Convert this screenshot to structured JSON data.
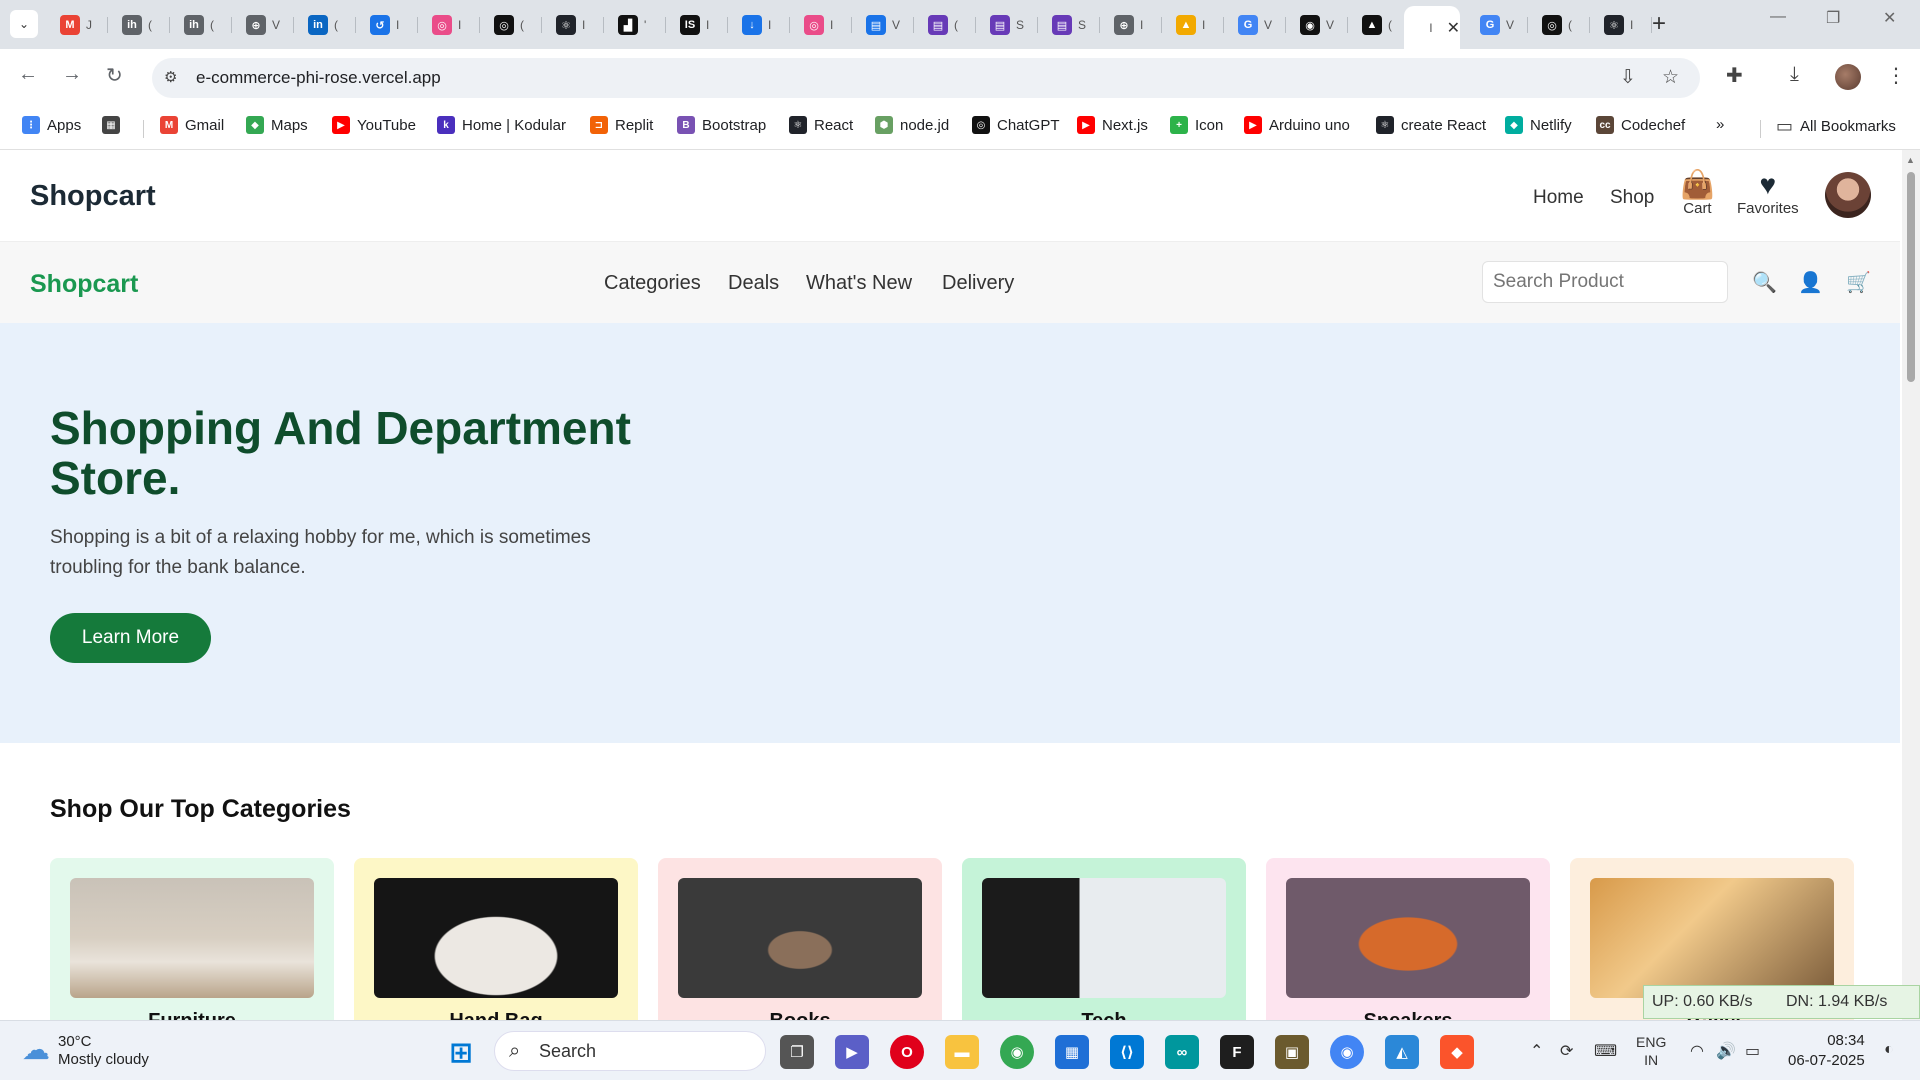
{
  "browser": {
    "tabs": [
      {
        "icon": "gmail-icon",
        "label": "M",
        "color": "#ea4335",
        "text": "J"
      },
      {
        "icon": "ih-icon",
        "label": "ih",
        "color": "#5f6368",
        "text": "("
      },
      {
        "icon": "ih-icon",
        "label": "ih",
        "color": "#5f6368",
        "text": "("
      },
      {
        "icon": "globe-icon",
        "label": "⊕",
        "color": "#5f6368",
        "text": "V"
      },
      {
        "icon": "linkedin-icon",
        "label": "in",
        "color": "#0a66c2",
        "text": "("
      },
      {
        "icon": "history-icon",
        "label": "↺",
        "color": "#1a73e8",
        "text": "I"
      },
      {
        "icon": "dribbble-icon",
        "label": "◎",
        "color": "#ea4c89",
        "text": "I"
      },
      {
        "icon": "chatgpt-icon",
        "label": "◎",
        "color": "#111",
        "text": "("
      },
      {
        "icon": "react-icon",
        "label": "⚛",
        "color": "#20232a",
        "text": "I"
      },
      {
        "icon": "unsplash-icon",
        "label": "▟",
        "color": "#111",
        "text": "'"
      },
      {
        "icon": "is-icon",
        "label": "IS",
        "color": "#111",
        "text": "I"
      },
      {
        "icon": "download-icon",
        "label": "↓",
        "color": "#1a73e8",
        "text": "I"
      },
      {
        "icon": "dribbble-icon",
        "label": "◎",
        "color": "#ea4c89",
        "text": "I"
      },
      {
        "icon": "forms-icon",
        "label": "▤",
        "color": "#1a73e8",
        "text": "V"
      },
      {
        "icon": "forms-icon",
        "label": "▤",
        "color": "#673ab7",
        "text": "("
      },
      {
        "icon": "forms-icon",
        "label": "▤",
        "color": "#673ab7",
        "text": "S"
      },
      {
        "icon": "forms-icon",
        "label": "▤",
        "color": "#673ab7",
        "text": "S"
      },
      {
        "icon": "globe-icon",
        "label": "⊕",
        "color": "#5f6368",
        "text": "I"
      },
      {
        "icon": "academy-icon",
        "label": "▲",
        "color": "#f2a900",
        "text": "I"
      },
      {
        "icon": "google-icon",
        "label": "G",
        "color": "#4285f4",
        "text": "V"
      },
      {
        "icon": "github-icon",
        "label": "◉",
        "color": "#111",
        "text": "V"
      },
      {
        "icon": "vercel-icon",
        "label": "▲",
        "color": "#111",
        "text": "("
      },
      {
        "icon": "page-icon",
        "label": "",
        "color": "#fff",
        "text": "I"
      },
      {
        "icon": "google-icon",
        "label": "G",
        "color": "#4285f4",
        "text": "V"
      },
      {
        "icon": "chatgpt-icon",
        "label": "◎",
        "color": "#111",
        "text": "("
      },
      {
        "icon": "react-icon",
        "label": "⚛",
        "color": "#20232a",
        "text": "I"
      }
    ],
    "url": "e-commerce-phi-rose.vercel.app",
    "bookmarks": [
      {
        "label": "Apps",
        "icon": "apps-icon",
        "color": "#4285f4",
        "glyph": "⋮"
      },
      {
        "label": "",
        "icon": "grid-icon",
        "color": "#444",
        "glyph": "▦"
      },
      {
        "label": "Gmail",
        "icon": "gmail-icon",
        "color": "#ea4335",
        "glyph": "M"
      },
      {
        "label": "Maps",
        "icon": "maps-icon",
        "color": "#34a853",
        "glyph": "◆"
      },
      {
        "label": "YouTube",
        "icon": "youtube-icon",
        "color": "#ff0000",
        "glyph": "▶"
      },
      {
        "label": "Home | Kodular",
        "icon": "kodular-icon",
        "color": "#4a2fbd",
        "glyph": "k"
      },
      {
        "label": "Replit",
        "icon": "replit-icon",
        "color": "#f26207",
        "glyph": "⊐"
      },
      {
        "label": "Bootstrap",
        "icon": "bootstrap-icon",
        "color": "#7952b3",
        "glyph": "B"
      },
      {
        "label": "React",
        "icon": "react-icon",
        "color": "#20232a",
        "glyph": "⚛"
      },
      {
        "label": "node.jd",
        "icon": "node-icon",
        "color": "#68a063",
        "glyph": "⬢"
      },
      {
        "label": "ChatGPT",
        "icon": "chatgpt-icon",
        "color": "#111",
        "glyph": "◎"
      },
      {
        "label": "Next.js",
        "icon": "youtube-icon",
        "color": "#ff0000",
        "glyph": "▶"
      },
      {
        "label": "Icon",
        "icon": "icon-site-icon",
        "color": "#2db34a",
        "glyph": "+"
      },
      {
        "label": "Arduino uno",
        "icon": "youtube-icon",
        "color": "#ff0000",
        "glyph": "▶"
      },
      {
        "label": "create React",
        "icon": "react-icon",
        "color": "#20232a",
        "glyph": "⚛"
      },
      {
        "label": "Netlify",
        "icon": "netlify-icon",
        "color": "#00ad9f",
        "glyph": "◆"
      },
      {
        "label": "Codechef",
        "icon": "codechef-icon",
        "color": "#5b4638",
        "glyph": "cc"
      }
    ],
    "more": "»",
    "all_bookmarks": "All Bookmarks"
  },
  "site": {
    "brand": "Shopcart",
    "nav": [
      "Home",
      "Shop"
    ],
    "cart_label": "Cart",
    "favorites_label": "Favorites",
    "sub_brand": "Shopcart",
    "subnav": [
      "Categories",
      "Deals",
      "What's New",
      "Delivery"
    ],
    "search_placeholder": "Search Product",
    "hero": {
      "title": "Shopping And Department Store.",
      "text": "Shopping is a bit of a relaxing hobby for me, which is sometimes troubling for the bank balance.",
      "button": "Learn More"
    },
    "categories_title": "Shop Our Top Categories",
    "categories": [
      {
        "name": "Furniture",
        "bg": "#e3f9ec"
      },
      {
        "name": "Hand Bag",
        "bg": "#fdf7c6"
      },
      {
        "name": "Books",
        "bg": "#fde3e3"
      },
      {
        "name": "Tech",
        "bg": "#c5f3d8"
      },
      {
        "name": "Sneakers",
        "bg": "#fde4ef"
      },
      {
        "name": "Travel",
        "bg": "#fdeedd"
      }
    ]
  },
  "netspeed": {
    "up": "UP: 0.60 KB/s",
    "down": "DN: 1.94 KB/s"
  },
  "taskbar": {
    "weather_temp": "30°C",
    "weather_desc": "Mostly cloudy",
    "search": "Search",
    "lang": "ENG",
    "region": "IN",
    "time": "08:34",
    "date": "06-07-2025"
  }
}
